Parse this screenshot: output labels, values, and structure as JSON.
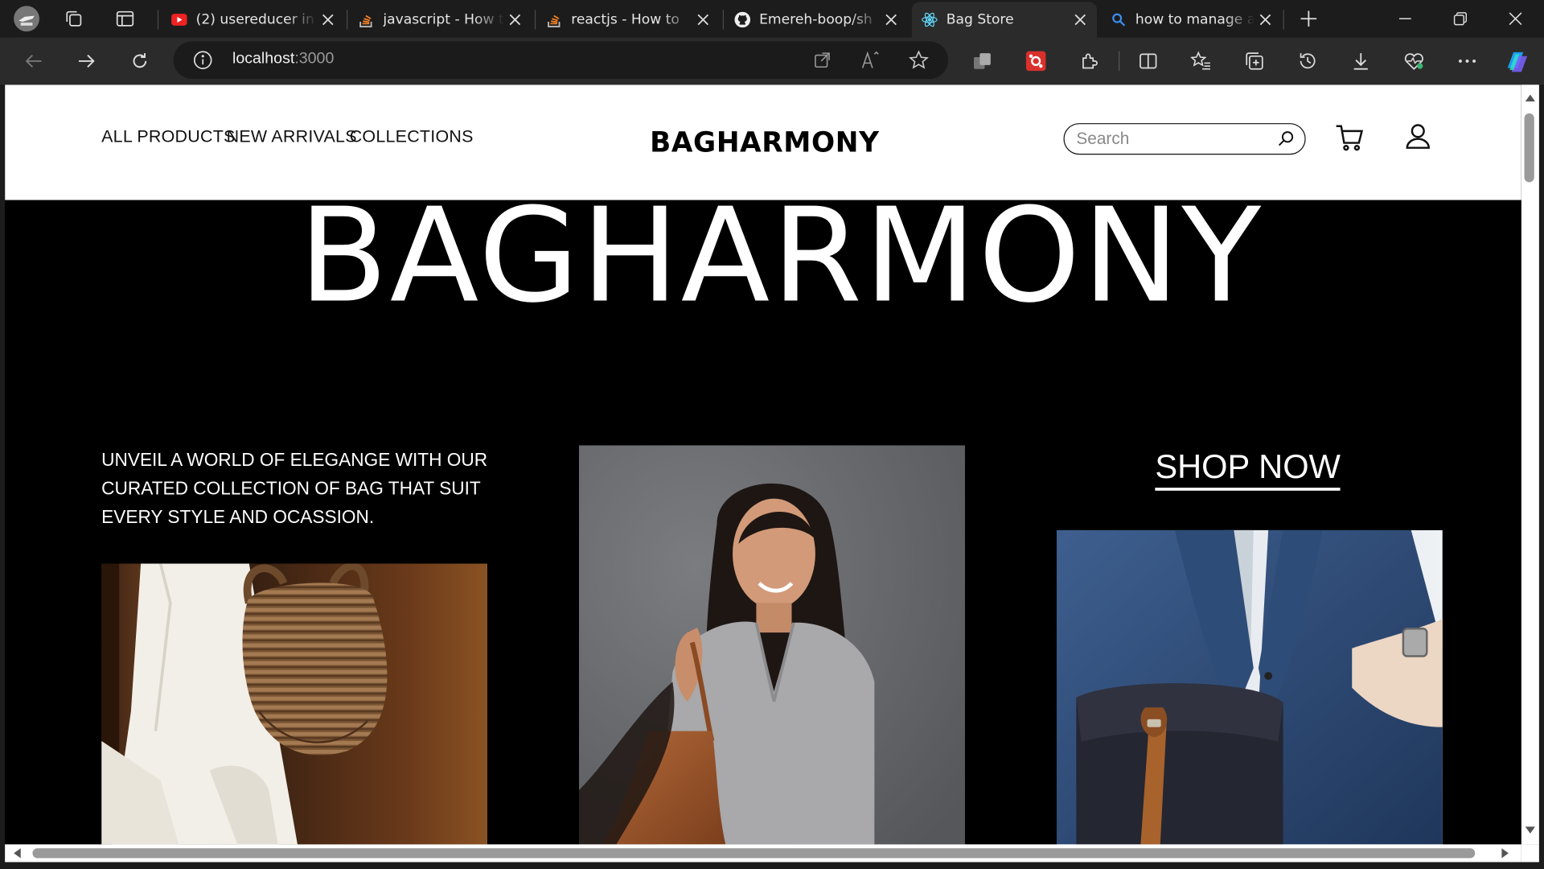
{
  "browser": {
    "tabs": [
      {
        "title": "(2) usereducer in",
        "icon": "youtube-icon"
      },
      {
        "title": "javascript - How t",
        "icon": "stackoverflow-icon"
      },
      {
        "title": "reactjs - How to",
        "icon": "stackoverflow-icon"
      },
      {
        "title": "Emereh-boop/sh",
        "icon": "github-icon"
      },
      {
        "title": "Bag Store",
        "icon": "react-icon",
        "active": true
      },
      {
        "title": "how to manage a",
        "icon": "bing-search-icon"
      }
    ],
    "url_host": "localhost",
    "url_port": ":3000"
  },
  "site": {
    "nav": {
      "all_products": "ALL PRODUCTS",
      "new_arrivals": "NEW ARRIVALS",
      "collections": "COLLECTIONS"
    },
    "logo": "BAGHARMONY",
    "search_placeholder": "Search"
  },
  "hero": {
    "title": "BAGHARMONY",
    "tagline": "UNVEIL A WORLD OF ELEGANGE WITH OUR CURATED COLLECTION OF BAG THAT SUIT EVERY STYLE AND OCASSION.",
    "cta": "SHOP NOW"
  },
  "colors": {
    "hero_bg": "#000000",
    "header_bg": "#ffffff",
    "browser_chrome": "#2b2b2b"
  }
}
